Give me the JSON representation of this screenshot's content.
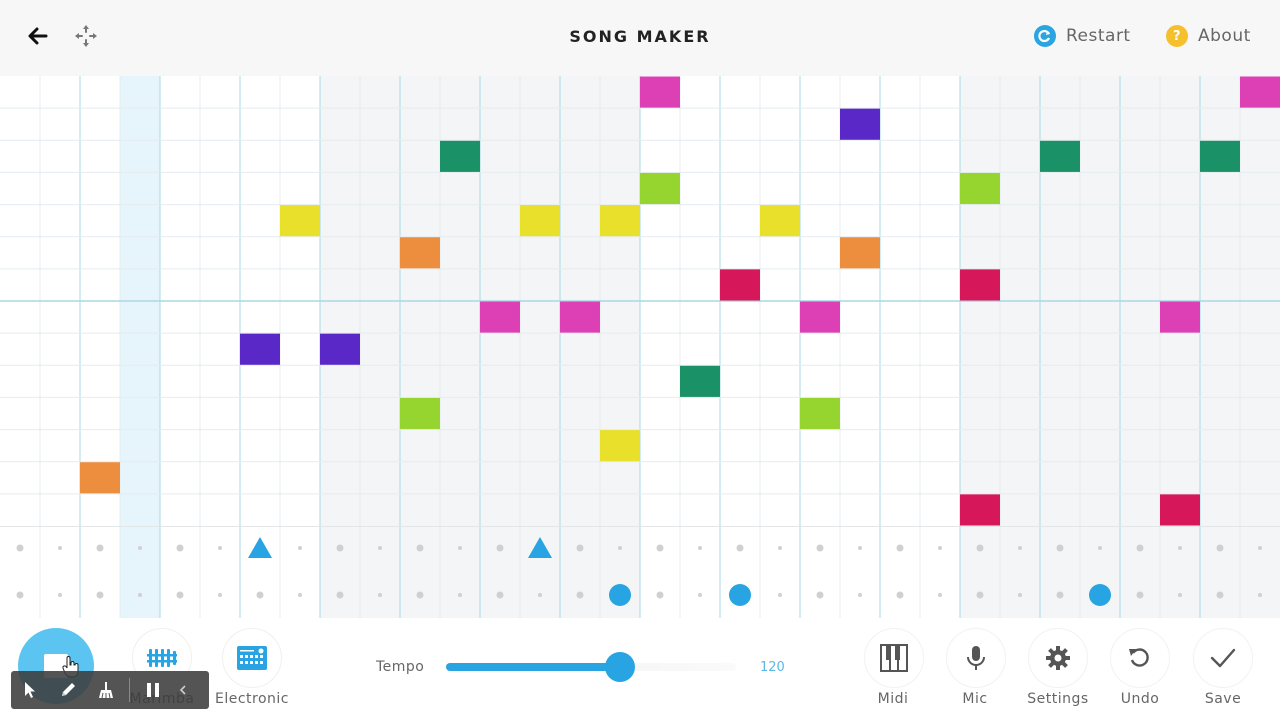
{
  "header": {
    "title": "SONG MAKER",
    "back_icon": "arrow-left-icon",
    "move_icon": "move-arrows-icon",
    "restart": {
      "label": "Restart",
      "icon": "restart-icon",
      "color": "#2aa5e0"
    },
    "about": {
      "label": "About",
      "icon": "question-icon",
      "glyph": "?",
      "color": "#f5c02b"
    }
  },
  "grid": {
    "columns": 32,
    "rows": 14,
    "beats_per_bar": 8,
    "shaded_bars": [
      1,
      3
    ],
    "highlight_column": 3,
    "octave_line_after_row": 6,
    "colors": {
      "bg_light": "#ffffff",
      "bg_shaded": "#f4f5f6",
      "highlight": "#e6f4fb",
      "line_minor": "#e4ecef",
      "line_major": "#a8d8e6"
    },
    "notes": [
      {
        "col": 16,
        "row": 0,
        "color": "#dd40b4"
      },
      {
        "col": 31,
        "row": 0,
        "color": "#dd40b4"
      },
      {
        "col": 21,
        "row": 1,
        "color": "#5a28c6"
      },
      {
        "col": 11,
        "row": 2,
        "color": "#1b9168"
      },
      {
        "col": 26,
        "row": 2,
        "color": "#1b9168"
      },
      {
        "col": 30,
        "row": 2,
        "color": "#1b9168"
      },
      {
        "col": 16,
        "row": 3,
        "color": "#96d430"
      },
      {
        "col": 24,
        "row": 3,
        "color": "#96d430"
      },
      {
        "col": 7,
        "row": 4,
        "color": "#e8e02a"
      },
      {
        "col": 13,
        "row": 4,
        "color": "#e8e02a"
      },
      {
        "col": 15,
        "row": 4,
        "color": "#e8e02a"
      },
      {
        "col": 19,
        "row": 4,
        "color": "#e8e02a"
      },
      {
        "col": 10,
        "row": 5,
        "color": "#ed8e3e"
      },
      {
        "col": 21,
        "row": 5,
        "color": "#ed8e3e"
      },
      {
        "col": 18,
        "row": 6,
        "color": "#d6185a"
      },
      {
        "col": 24,
        "row": 6,
        "color": "#d6185a"
      },
      {
        "col": 12,
        "row": 7,
        "color": "#dd40b4"
      },
      {
        "col": 14,
        "row": 7,
        "color": "#dd40b4"
      },
      {
        "col": 20,
        "row": 7,
        "color": "#dd40b4"
      },
      {
        "col": 29,
        "row": 7,
        "color": "#dd40b4"
      },
      {
        "col": 6,
        "row": 8,
        "color": "#5a28c6"
      },
      {
        "col": 8,
        "row": 8,
        "color": "#5a28c6"
      },
      {
        "col": 17,
        "row": 9,
        "color": "#1b9168"
      },
      {
        "col": 10,
        "row": 10,
        "color": "#96d430"
      },
      {
        "col": 20,
        "row": 10,
        "color": "#96d430"
      },
      {
        "col": 15,
        "row": 11,
        "color": "#e8e02a"
      },
      {
        "col": 2,
        "row": 12,
        "color": "#ed8e3e"
      },
      {
        "col": 24,
        "row": 13,
        "color": "#d6185a"
      },
      {
        "col": 29,
        "row": 13,
        "color": "#d6185a"
      }
    ]
  },
  "percussion": {
    "accent_color": "#27a4e1",
    "triangles": [
      6,
      13
    ],
    "circles": [
      15,
      18,
      27
    ]
  },
  "bottom": {
    "play_button_icon": "stop-icon",
    "instruments": [
      {
        "label": "Marimba",
        "icon": "marimba-icon"
      },
      {
        "label": "Electronic",
        "icon": "electronic-icon"
      }
    ],
    "tempo": {
      "label": "Tempo",
      "value": "120",
      "fraction": 0.6
    },
    "tools": [
      {
        "label": "Midi",
        "icon": "piano-keys-icon"
      },
      {
        "label": "Mic",
        "icon": "microphone-icon"
      },
      {
        "label": "Settings",
        "icon": "gear-icon"
      },
      {
        "label": "Undo",
        "icon": "undo-icon"
      },
      {
        "label": "Save",
        "icon": "checkmark-icon"
      }
    ]
  },
  "overlay_toolbar": {
    "tools": [
      "pointer-icon",
      "pencil-icon",
      "broom-icon",
      "pause-icon",
      "collapse-chevron-icon"
    ]
  }
}
